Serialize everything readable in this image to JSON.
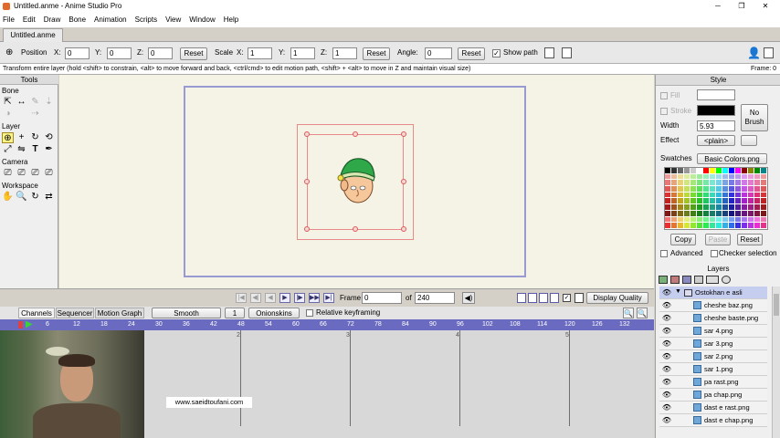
{
  "window": {
    "title": "Untitled.anme - Anime Studio Pro",
    "minimize": "─",
    "restore": "❐",
    "close": "✕"
  },
  "menu": [
    "File",
    "Edit",
    "Draw",
    "Bone",
    "Animation",
    "Scripts",
    "View",
    "Window",
    "Help"
  ],
  "doc_tab": "Untitled.anme",
  "toolbar": {
    "position_label": "Position",
    "x_label": "X:",
    "x": "0",
    "y_label": "Y:",
    "y": "0",
    "z_label": "Z:",
    "z": "0",
    "reset1": "Reset",
    "scale_label": "Scale",
    "sx_label": "X:",
    "sx": "1",
    "sy_label": "Y:",
    "sy": "1",
    "sz_label": "Z:",
    "sz": "1",
    "reset2": "Reset",
    "angle_label": "Angle:",
    "angle": "0",
    "reset3": "Reset",
    "show_path": "Show path"
  },
  "status": {
    "message": "Transform entire layer (hold <shift> to constrain, <alt> to move forward and back, <ctrl/cmd> to edit motion path, <shift> + <alt> to move in Z and maintain visual size)",
    "frame": "Frame: 0"
  },
  "tools": {
    "title": "Tools",
    "bone": "Bone",
    "layer": "Layer",
    "camera": "Camera",
    "workspace": "Workspace"
  },
  "style": {
    "title": "Style",
    "fill": "Fill",
    "stroke": "Stroke",
    "width_label": "Width",
    "width": "5.93",
    "no_brush": "No\nBrush",
    "effect_label": "Effect",
    "effect": "<plain>",
    "swatches_label": "Swatches",
    "swatches": "Basic Colors.png",
    "copy": "Copy",
    "paste": "Paste",
    "reset": "Reset",
    "advanced": "Advanced",
    "checker": "Checker selection",
    "fill_color": "#ffffff",
    "stroke_color": "#000000"
  },
  "layers": {
    "title": "Layers",
    "items": [
      {
        "name": "Ostokhan e asli",
        "selected": true,
        "group": true
      },
      {
        "name": "cheshe baz.png"
      },
      {
        "name": "cheshe baste.png"
      },
      {
        "name": "sar 4.png"
      },
      {
        "name": "sar 3.png"
      },
      {
        "name": "sar 2.png"
      },
      {
        "name": "sar 1.png"
      },
      {
        "name": "pa rast.png"
      },
      {
        "name": "pa chap.png"
      },
      {
        "name": "dast e rast.png"
      },
      {
        "name": "dast e chap.png"
      }
    ]
  },
  "playback": {
    "frame_label": "Frame",
    "frame": "0",
    "of_label": "of",
    "total": "240",
    "display_quality": "Display Quality"
  },
  "timeline": {
    "tabs": [
      "Channels",
      "Sequencer",
      "Motion Graph"
    ],
    "interp": "Smooth",
    "interp_val": "1",
    "onionskins": "Onionskins",
    "relative": "Relative keyframing",
    "ruler": [
      "0",
      "6",
      "12",
      "18",
      "24",
      "30",
      "36",
      "42",
      "48",
      "54",
      "60",
      "66",
      "72",
      "78",
      "84",
      "90",
      "96",
      "102",
      "108",
      "114",
      "120",
      "126",
      "132"
    ],
    "markers": [
      "2",
      "3",
      "4",
      "5"
    ]
  },
  "watermark": "www.saeidtoufani.com"
}
